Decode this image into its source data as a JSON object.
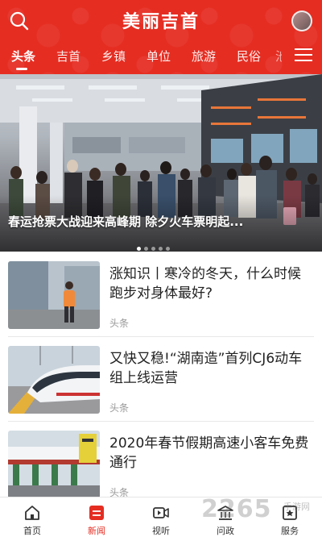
{
  "app": {
    "logo_text": "美丽吉首"
  },
  "tabs": [
    {
      "label": "头条",
      "active": true
    },
    {
      "label": "吉首"
    },
    {
      "label": "乡镇"
    },
    {
      "label": "单位"
    },
    {
      "label": "旅游"
    },
    {
      "label": "民俗"
    },
    {
      "label": "池"
    }
  ],
  "banner": {
    "caption": "春运抢票大战迎来高峰期 除夕火车票明起...",
    "slide_count": 5,
    "current_slide": 1
  },
  "news": [
    {
      "title": "涨知识丨寒冷的冬天，什么时候跑步对身体最好?",
      "source": "头条"
    },
    {
      "title": "又快又稳!“湖南造”首列CJ6动车组上线运营",
      "source": "头条"
    },
    {
      "title": "2020年春节假期高速小客车免费通行",
      "source": "头条"
    }
  ],
  "bottom_nav": [
    {
      "label": "首页",
      "icon": "home-icon"
    },
    {
      "label": "新闻",
      "icon": "news-icon",
      "active": true
    },
    {
      "label": "视听",
      "icon": "video-icon"
    },
    {
      "label": "问政",
      "icon": "government-icon"
    },
    {
      "label": "服务",
      "icon": "service-icon"
    }
  ],
  "watermark": {
    "text": "2265",
    "sub": "手游网",
    "suffix": ".com"
  },
  "colors": {
    "brand": "#e52d22",
    "text": "#222222",
    "muted": "#999999"
  }
}
